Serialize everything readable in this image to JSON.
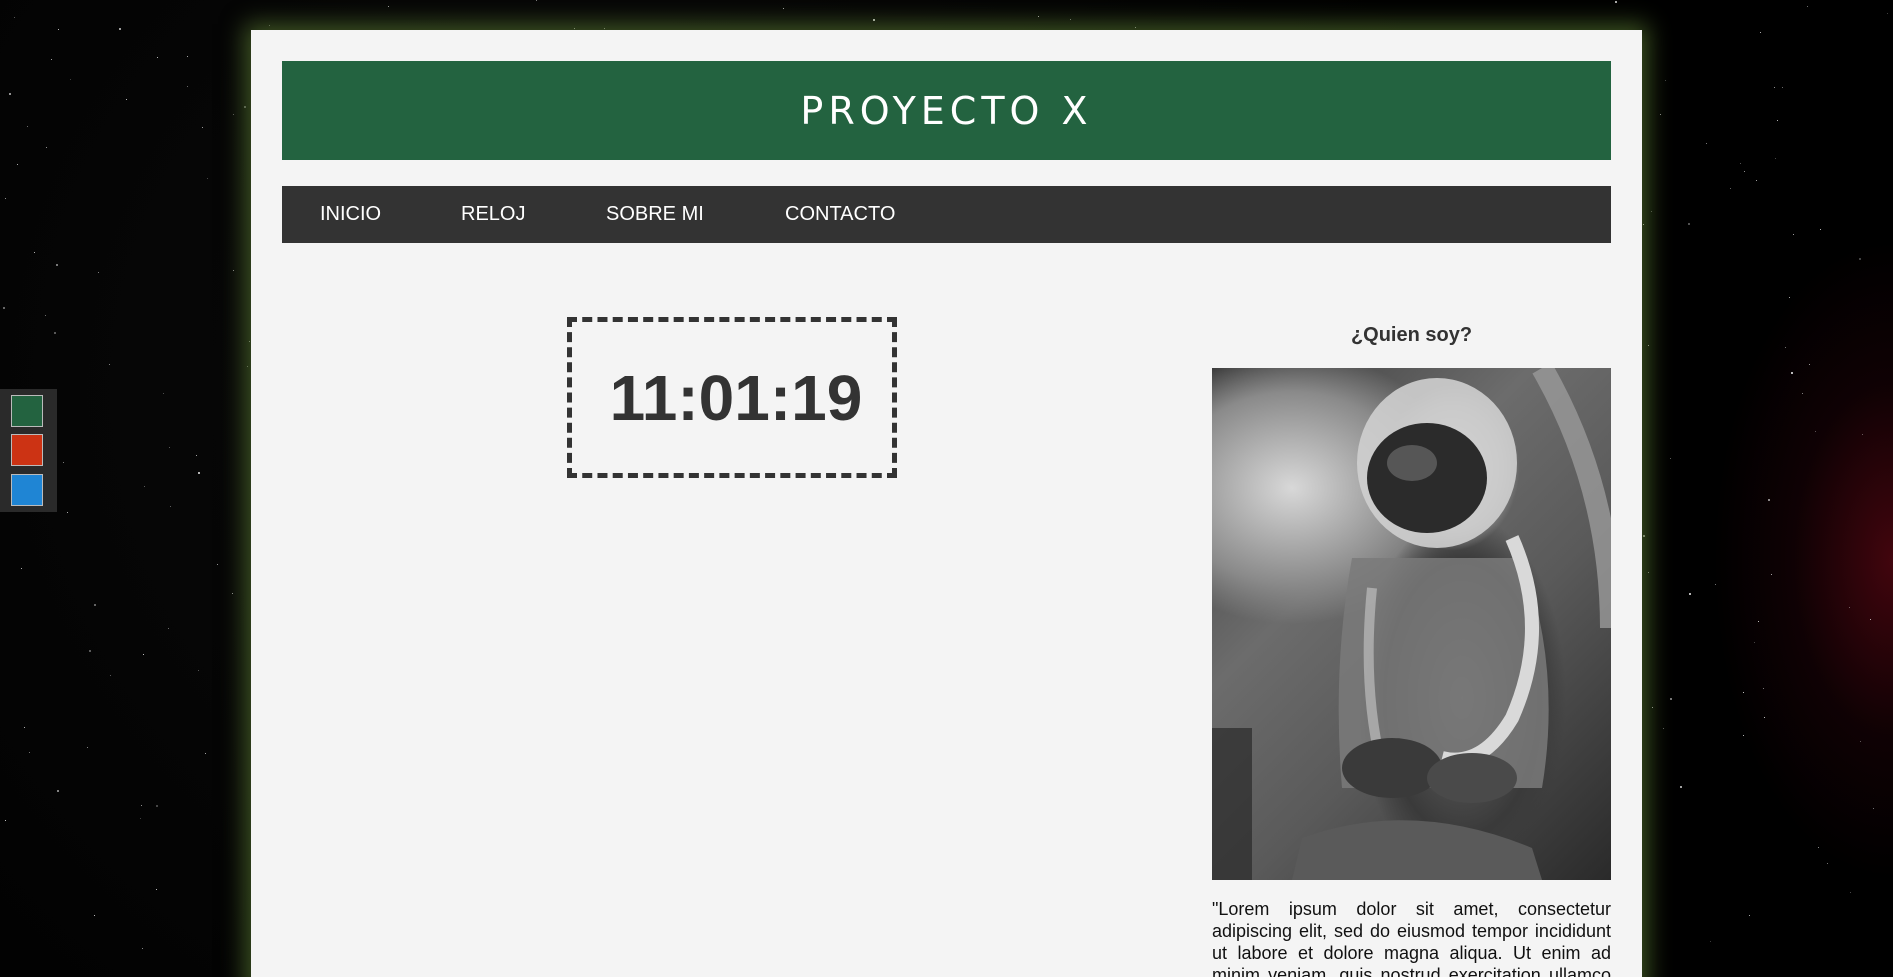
{
  "site": {
    "title": "PROYECTO X"
  },
  "nav": {
    "items": [
      {
        "label": "INICIO"
      },
      {
        "label": "RELOJ"
      },
      {
        "label": "SOBRE MI"
      },
      {
        "label": "CONTACTO"
      }
    ]
  },
  "clock": {
    "time": "11:01:19"
  },
  "aside": {
    "heading": "¿Quien soy?",
    "bio": "\"Lorem ipsum dolor sit amet, consectetur adipiscing elit, sed do eiusmod tempor incididunt ut labore et dolore magna aliqua. Ut enim ad minim veniam, quis nostrud exercitation ullamco laboris nisi ut aliquip ex ea commodo consequat."
  },
  "theme_switcher": {
    "colors": {
      "green": "#236340",
      "red": "#cc3314",
      "blue": "#1f85d4"
    }
  },
  "colors": {
    "header_bg": "#236340",
    "nav_bg": "#333333",
    "page_bg": "#f4f4f4",
    "text_dark": "#333333"
  }
}
